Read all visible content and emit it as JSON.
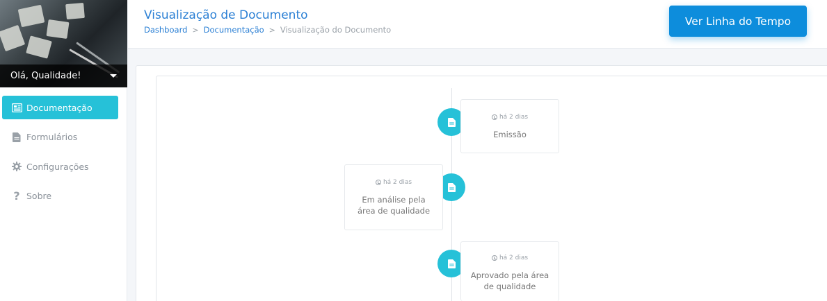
{
  "sidebar": {
    "greeting": "Olá, Qualidade!",
    "items": [
      {
        "label": "Documentação",
        "icon": "newspaper-icon",
        "active": true
      },
      {
        "label": "Formulários",
        "icon": "file-icon",
        "active": false
      },
      {
        "label": "Configurações",
        "icon": "gear-icon",
        "active": false
      },
      {
        "label": "Sobre",
        "icon": "question-icon",
        "active": false
      }
    ]
  },
  "header": {
    "title": "Visualização de Documento",
    "breadcrumb": {
      "dashboard": "Dashboard",
      "docs": "Documentação",
      "current": "Visualização do Documento",
      "separator": ">"
    },
    "timeline_button": "Ver Linha do Tempo"
  },
  "timeline": {
    "events": [
      {
        "time": "há 2 dias",
        "label": "Emissão",
        "side": "right"
      },
      {
        "time": "há 2 dias",
        "label": "Em análise pela área de qualidade",
        "side": "left"
      },
      {
        "time": "há 2 dias",
        "label": "Aprovado pela área de qualidade",
        "side": "right"
      }
    ]
  },
  "colors": {
    "accent": "#26c1d8",
    "primary": "#0d8ddc",
    "title": "#2a7fd4"
  }
}
